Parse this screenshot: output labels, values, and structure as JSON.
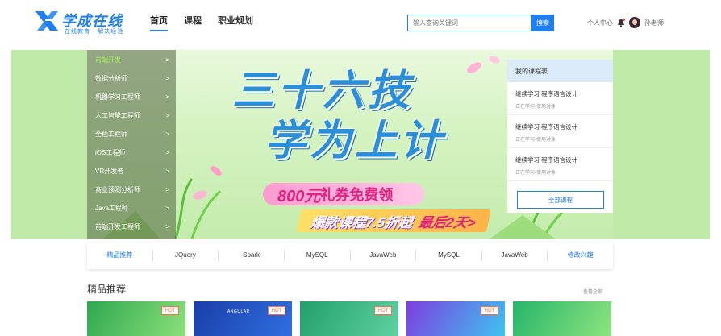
{
  "header": {
    "logo_title": "学成在线",
    "logo_subtitle": "在线教育 · 解决经验",
    "nav": [
      {
        "label": "首页",
        "active": true
      },
      {
        "label": "课程",
        "active": false
      },
      {
        "label": "职业规划",
        "active": false
      }
    ],
    "search": {
      "placeholder": "输入查询关键词",
      "button_label": "搜索"
    },
    "user": {
      "center_label": "个人中心",
      "name": "孙老师"
    }
  },
  "banner": {
    "headline_line1": "三十六技",
    "headline_line2": "学为上计",
    "coupon_amount": "800元",
    "coupon_text": "礼券免费领",
    "promo_text": "爆款课程7.5折起",
    "promo_deadline": "最后2天>",
    "categories": [
      {
        "label": "前端开发",
        "active": true
      },
      {
        "label": "数据分析师",
        "active": false
      },
      {
        "label": "机器学习工程师",
        "active": false
      },
      {
        "label": "人工智能工程师",
        "active": false
      },
      {
        "label": "全栈工程师",
        "active": false
      },
      {
        "label": "iOS工程师",
        "active": false
      },
      {
        "label": "VR开发者",
        "active": false
      },
      {
        "label": "商业预测分析师",
        "active": false
      },
      {
        "label": "Java工程师",
        "active": false
      },
      {
        "label": "前端开发工程师",
        "active": false
      }
    ],
    "arrow_glyph": ">",
    "my_courses": {
      "title": "我的课程表",
      "items": [
        {
          "name": "继续学习 程序语言设计",
          "status": "正在学习-使用对象"
        },
        {
          "name": "继续学习 程序语言设计",
          "status": "正在学习-使用对象"
        },
        {
          "name": "继续学习 程序语言设计",
          "status": "正在学习-使用对象"
        }
      ],
      "all_button": "全部课程"
    }
  },
  "tags": [
    "精品推荐",
    "JQuery",
    "Spark",
    "MySQL",
    "JavaWeb",
    "MySQL",
    "JavaWeb",
    "修改兴趣"
  ],
  "recommend": {
    "title": "精品推荐",
    "view_all": "查看全部",
    "hot_label": "HOT",
    "cards": [
      {
        "brand": ""
      },
      {
        "brand": "ANGULAR"
      },
      {
        "brand": ""
      },
      {
        "brand": ""
      },
      {
        "brand": ""
      }
    ]
  },
  "colors": {
    "brand_blue": "#1f7ef0",
    "banner_green": "#bfe9a7",
    "hot_orange": "#ff6a3d",
    "card_gradients": [
      [
        "#2fa84f",
        "#8be07a"
      ],
      [
        "#1a3ea8",
        "#2f6fe0"
      ],
      [
        "#22a06b",
        "#5fd1a0"
      ],
      [
        "#7d3fe0",
        "#3ec3f0"
      ],
      [
        "#26b56a",
        "#8ee37f"
      ]
    ]
  }
}
